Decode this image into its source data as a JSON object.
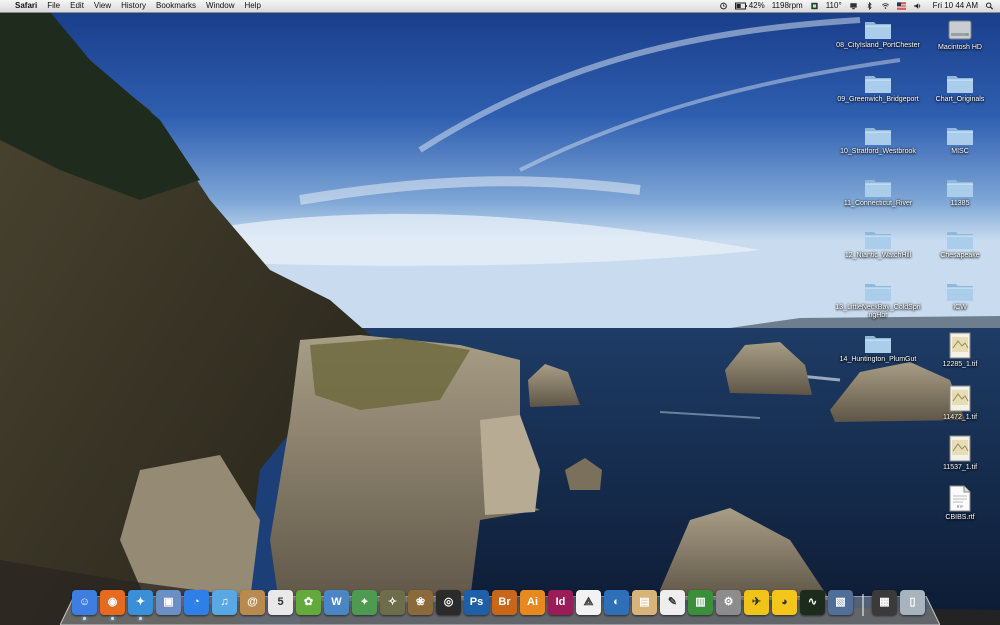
{
  "menubar": {
    "apple_symbol": "",
    "app_name": "Safari",
    "menus": [
      "File",
      "Edit",
      "View",
      "History",
      "Bookmarks",
      "Window",
      "Help"
    ],
    "status": {
      "battery_percent": "42%",
      "fan_speed": "1198rpm",
      "temperature": "110°",
      "clock": "Fri 10 44 AM"
    }
  },
  "desktop": {
    "icons": [
      {
        "label": "08_CityIsland_PortChester",
        "type": "folder"
      },
      {
        "label": "Macintosh HD",
        "type": "drive"
      },
      {
        "label": "09_Greenwich_Bridgeport",
        "type": "folder"
      },
      {
        "label": "Chart_Originals",
        "type": "folder"
      },
      {
        "label": "10_Stratford_Westbrook",
        "type": "folder"
      },
      {
        "label": "MISC",
        "type": "folder"
      },
      {
        "label": "11_Connecticut_River",
        "type": "folder"
      },
      {
        "label": "11385",
        "type": "folder"
      },
      {
        "label": "12_Niantic_WatchHill",
        "type": "folder"
      },
      {
        "label": "Chesapeake",
        "type": "folder"
      },
      {
        "label": "13_LittleNeckBay_ColdSpringHbr",
        "type": "folder"
      },
      {
        "label": "ICW",
        "type": "folder"
      },
      {
        "label": "14_Huntington_PlumGut",
        "type": "folder"
      },
      {
        "label": "12285_1.tif",
        "type": "image"
      },
      {
        "label": "11472_1.tif",
        "type": "image"
      },
      {
        "label": "11537_1.tif",
        "type": "image"
      },
      {
        "label": "CBIBS.rtf",
        "type": "document",
        "doc_tag": "RTF"
      }
    ]
  },
  "dock": {
    "items": [
      {
        "icon": "finder-icon",
        "glyph": "☺",
        "color": "#3d7ee0",
        "running": true
      },
      {
        "icon": "firefox-icon",
        "glyph": "◉",
        "color": "#e66a1f",
        "running": true
      },
      {
        "icon": "safari-icon",
        "glyph": "✦",
        "color": "#3b8fd9",
        "running": true
      },
      {
        "icon": "preview-icon",
        "glyph": "▣",
        "color": "#6a8fc4",
        "running": false
      },
      {
        "icon": "ichat-icon",
        "glyph": "◔",
        "color": "#2f7fe8",
        "running": false
      },
      {
        "icon": "itunes-icon",
        "glyph": "♫",
        "color": "#5aa7e6",
        "running": false
      },
      {
        "icon": "address-book-icon",
        "glyph": "@",
        "color": "#b98a4e",
        "running": false
      },
      {
        "icon": "ical-icon",
        "glyph": "5",
        "color": "#e9e9e9",
        "running": false
      },
      {
        "icon": "coda-icon",
        "glyph": "✿",
        "color": "#63a93c",
        "running": false
      },
      {
        "icon": "textwrangler-icon",
        "glyph": "W",
        "color": "#4a86c4",
        "running": false
      },
      {
        "icon": "chart-app-icon",
        "glyph": "⌖",
        "color": "#4d9a50",
        "running": false
      },
      {
        "icon": "compass-app-icon",
        "glyph": "✧",
        "color": "#6d6d4a",
        "running": false
      },
      {
        "icon": "iphoto-icon",
        "glyph": "❀",
        "color": "#8a6a3a",
        "running": false
      },
      {
        "icon": "aperture-icon",
        "glyph": "◎",
        "color": "#2b2b2b",
        "running": false
      },
      {
        "icon": "photoshop-icon",
        "glyph": "Ps",
        "color": "#1f5fa8",
        "running": false
      },
      {
        "icon": "bridge-icon",
        "glyph": "Br",
        "color": "#c8661a",
        "running": false
      },
      {
        "icon": "illustrator-icon",
        "glyph": "Ai",
        "color": "#e7891f",
        "running": false
      },
      {
        "icon": "indesign-icon",
        "glyph": "Id",
        "color": "#9a1d5a",
        "running": false
      },
      {
        "icon": "acrobat-icon",
        "glyph": "⟁",
        "color": "#f2f2f2",
        "running": false
      },
      {
        "icon": "google-earth-icon",
        "glyph": "◐",
        "color": "#2f6fb8",
        "running": false
      },
      {
        "icon": "archive-utility-icon",
        "glyph": "▤",
        "color": "#d7b57a",
        "running": false
      },
      {
        "icon": "textedit-icon",
        "glyph": "✎",
        "color": "#eeeeee",
        "running": false
      },
      {
        "icon": "photo-booth-icon",
        "glyph": "▥",
        "color": "#3b8f3b",
        "running": false
      },
      {
        "icon": "system-preferences-icon",
        "glyph": "⚙",
        "color": "#8c8c8c",
        "running": false
      },
      {
        "icon": "cyberduck-bird-icon",
        "glyph": "✈",
        "color": "#f0c419",
        "running": false
      },
      {
        "icon": "rubber-duck-icon",
        "glyph": "◕",
        "color": "#f5c61a",
        "running": false
      },
      {
        "icon": "activity-monitor-icon",
        "glyph": "∿",
        "color": "#1c2b1c",
        "running": false
      },
      {
        "icon": "photos-slideshow-icon",
        "glyph": "▧",
        "color": "#4f6f9a",
        "running": false
      },
      {
        "separator": true
      },
      {
        "icon": "stack-folder-icon",
        "glyph": "▦",
        "color": "#3a3a3a",
        "running": false
      },
      {
        "icon": "trash-icon",
        "glyph": "▯",
        "color": "#a9b3bd",
        "running": false
      }
    ]
  }
}
